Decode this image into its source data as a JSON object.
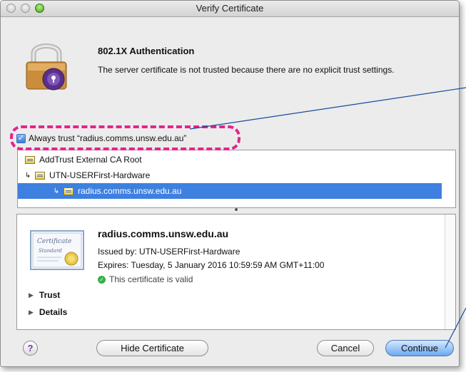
{
  "window": {
    "title": "Verify Certificate"
  },
  "auth": {
    "heading": "802.1X Authentication",
    "message": "The server certificate is not trusted because there are no explicit trust settings."
  },
  "trust": {
    "label": "Always trust “radius.comms.unsw.edu.au”",
    "checked": true
  },
  "chain": {
    "items": [
      {
        "label": "AddTrust External CA Root",
        "selected": false
      },
      {
        "label": "UTN-USERFirst-Hardware",
        "selected": false
      },
      {
        "label": "radius.comms.unsw.edu.au",
        "selected": true
      }
    ]
  },
  "certificate": {
    "name": "radius.comms.unsw.edu.au",
    "issued_by": "Issued by: UTN-USERFirst-Hardware",
    "expires": "Expires: Tuesday, 5 January 2016 10:59:59 AM GMT+11:00",
    "status": "This certificate is valid",
    "badge_line1": "Certificate",
    "badge_line2": "Standard"
  },
  "sections": {
    "trust": "Trust",
    "details": "Details"
  },
  "buttons": {
    "help": "?",
    "hide_certificate": "Hide Certificate",
    "cancel": "Cancel",
    "continue": "Continue"
  },
  "colors": {
    "highlight": "#e5238e",
    "selection": "#3d80df",
    "valid": "#34b045"
  }
}
